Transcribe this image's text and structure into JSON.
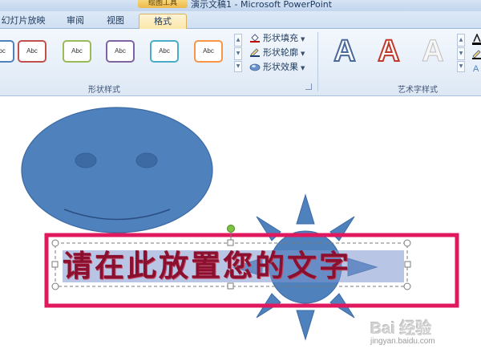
{
  "window": {
    "title": "演示文稿1 - Microsoft PowerPoint",
    "context_label": "绘图工具"
  },
  "tabs": {
    "slideshow": "幻灯片放映",
    "review": "审阅",
    "view": "视图",
    "format": "格式"
  },
  "ribbon": {
    "shape_styles": {
      "swatch_label": "Abc",
      "swatch_colors": [
        "#4f81bd",
        "#c0504d",
        "#9bbb59",
        "#8064a2",
        "#4bacc6",
        "#f79646"
      ],
      "group_label": "形状样式",
      "fill": "形状填充",
      "outline": "形状轮廓",
      "effects": "形状效果"
    },
    "wordart_styles": {
      "sample": "A",
      "group_label": "艺术字样式"
    }
  },
  "slide": {
    "shape_colors": {
      "fill": "#4f81bd",
      "outline": "#3a6aa5",
      "selection_frame": "#e0195f",
      "rotate_handle": "#7dc242"
    },
    "placeholder_text": "请在此放置您的文字"
  },
  "watermark": {
    "brand": "Bai 经验",
    "url": "jingyan.baidu.com"
  }
}
